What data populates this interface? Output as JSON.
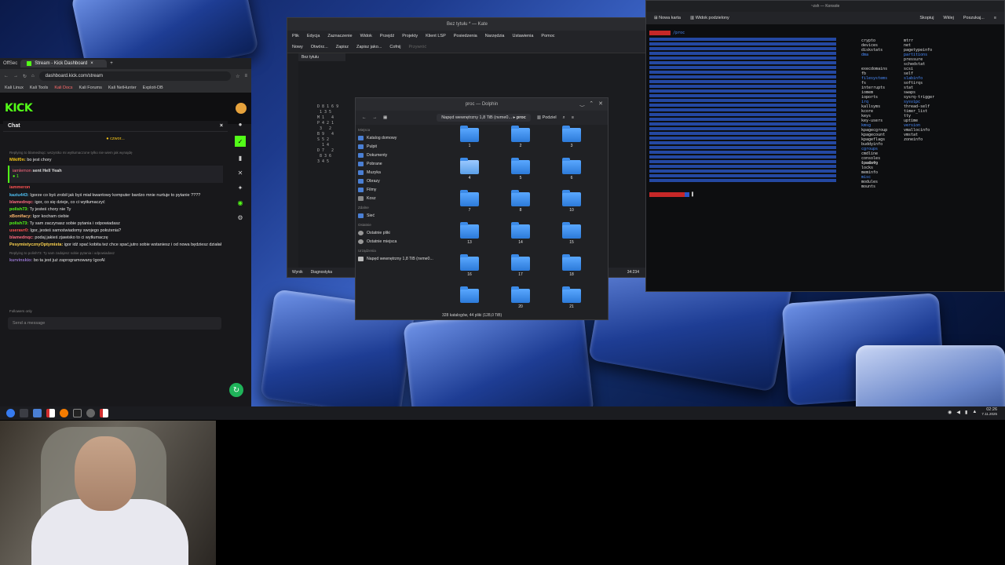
{
  "browser": {
    "tab_title": "Stream - Kick Dashboard",
    "tab_office": "OffSec",
    "url": "dashboard.kick.com/stream",
    "bookmarks": [
      "Kali Linux",
      "Kali Tools",
      "Kali Docs",
      "Kali Forums",
      "Kali NetHunter",
      "Exploit-DB"
    ],
    "logo": "KICK"
  },
  "chat": {
    "title": "Chat",
    "pinned": "czwor...",
    "reply1": "Replying to blamednqc: wszystko mi wytłumaczone tylko nie wiem jak wynajdę",
    "messages": [
      {
        "user": "Mikif0n:",
        "text": "bo jest chory",
        "color": "#f5c518"
      },
      {
        "user": "kaziu443:",
        "text": "Igorze co byś zrobił jak byś miał kwantowy komputer bardzo mnie nurtuje to pytanie ????",
        "color": "#4fc3f7"
      },
      {
        "user": "blamednqc:",
        "text": "igor, co się dzieje, co ci wytłumaczyć",
        "color": "#ff6b81"
      },
      {
        "user": "polish73:",
        "text": "Ty jesteś chory nie Ty",
        "color": "#53fc18"
      },
      {
        "user": "xBonifacy:",
        "text": "Igor kocham ciebie",
        "color": "#ffb86c"
      },
      {
        "user": "polish73:",
        "text": "Ty sam zaczynasz sobie pytania i odpowiadasz",
        "color": "#53fc18"
      },
      {
        "user": "useravr0:",
        "text": "Igor, jesteś samoświadomy swojego położenia?",
        "color": "#ff5252"
      },
      {
        "user": "blamednqc:",
        "text": "podaj jakieś zjawisko to ci wytłumaczę",
        "color": "#ff6b81"
      },
      {
        "user": "PesymistycznyOptymista:",
        "text": "igor idź spać kobita też chce spać,jutro sobie wstaniesz i od nowa będziesz działał",
        "color": "#ffd54f"
      },
      {
        "user": "kurvinskio:",
        "text": "bo ta jest już zaprogramowany IgorAI",
        "color": "#9575cd"
      }
    ],
    "highlight_user": "iamlemon",
    "highlight_text": "sent Hell Yeah",
    "highlight_count": "1",
    "reply2": "Replying to polish73: Ty sam zadajesz sobie pytania i odpowiadasz",
    "following": "Followers only",
    "input_placeholder": "Send a message"
  },
  "kate": {
    "title": "Bez tytułu * — Kate",
    "menu": [
      "Plik",
      "Edycja",
      "Zaznaczenie",
      "Widok",
      "Przejdź",
      "Projekty",
      "Klient LSP",
      "Posiedzenia",
      "Narzędzia",
      "Ustawienia",
      "Pomoc"
    ],
    "toolbar": [
      "Nowy",
      "Otwórz...",
      "Zapisz",
      "Zapisz jako...",
      "Cofnij",
      "Przywróć"
    ],
    "tab": "Bez tytułu",
    "doc_name": "Bez tytułu",
    "status": [
      "Wynik",
      "Diagnostyka"
    ],
    "pos": "34:234"
  },
  "dolphin": {
    "title": "proc — Dolphin",
    "drive": "Napęd wewnętrzny 1,8 TiB (nvme0...",
    "crumb": "proc",
    "split": "Podziel",
    "places_header": "Miejsca",
    "places": [
      "Katalog domowy",
      "Pulpit",
      "Dokumenty",
      "Pobrane",
      "Muzyka",
      "Obrazy",
      "Filmy",
      "Kosz"
    ],
    "remote_header": "Zdalne",
    "remote": [
      "Sieć"
    ],
    "recent_header": "Ostatnie",
    "recent": [
      "Ostatnie pliki",
      "Ostatnie miejsca"
    ],
    "devices_header": "Urządzenia",
    "devices": [
      "Napęd wewnętrzny 1,8 TiB (nvme0..."
    ],
    "folders": [
      "1",
      "2",
      "3",
      "4",
      "5",
      "6",
      "7",
      "8",
      "10",
      "13",
      "14",
      "15",
      "16",
      "17",
      "18",
      "20",
      "21"
    ],
    "status": "328 katalogów, 44 pliki (128,0 TiB)"
  },
  "konsole": {
    "title": "~zsh — Konsole",
    "tab": "Nowa karta",
    "split": "Widok podzielony",
    "right": [
      "Skopiuj",
      "Wklej",
      "Poszukaj..."
    ],
    "cwd": "/proc",
    "files_col1": [
      "crypto",
      "devices",
      "diskstats",
      "dma",
      "",
      "",
      "execdomains",
      "fb",
      "filesystems",
      "fs",
      "interrupts",
      "iomem",
      "ioports",
      "irq",
      "kallsyms",
      "kcore",
      "keys",
      "key-users",
      "kmsg",
      "kpagecgroup",
      "kpagecount",
      "kpageflags",
      "buddyinfo",
      "cgroups",
      "cmdline",
      "consoles",
      "cpuinfo"
    ],
    "files_col2": [
      "mtrr",
      "net",
      "pagetypeinfo",
      "partitions",
      "pressure",
      "schedstat",
      "scsi",
      "self",
      "slabinfo",
      "softirqs",
      "stat",
      "swaps",
      "sysrq-trigger",
      "sysvipc",
      "thread-self",
      "timer_list",
      "tty",
      "uptime",
      "version",
      "vmallocinfo",
      "vmstat",
      "zoneinfo",
      "",
      "",
      "",
      "",
      ""
    ],
    "files_col3": [
      "loadavg",
      "locks",
      "meminfo",
      "misc",
      "modules",
      "mounts"
    ]
  },
  "clock": {
    "time": "02:26",
    "date": "7.11.2025"
  }
}
